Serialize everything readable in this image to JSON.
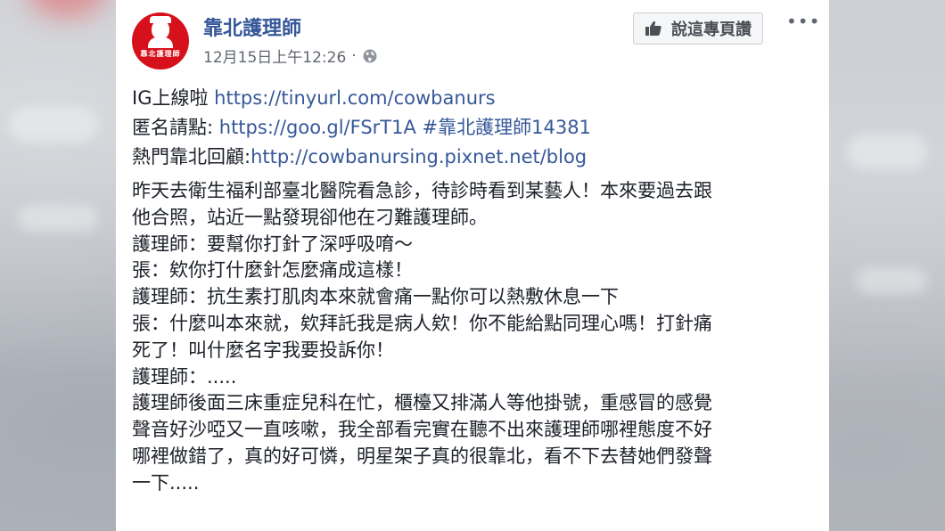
{
  "post": {
    "page_name": "靠北護理師",
    "avatar_text": "靠北護理師",
    "timestamp": "12月15日上午12:26",
    "separator": "·",
    "like_page_label": "說這專頁讚",
    "more_label": "•••"
  },
  "links": [
    {
      "prefix": "IG上線啦 ",
      "link": "https://tinyurl.com/cowbanurs"
    },
    {
      "prefix": "匿名請點: ",
      "link": "https://goo.gl/FSrT1A #靠北護理師14381"
    },
    {
      "prefix": "熱門靠北回顧:",
      "link": "http://cowbanursing.pixnet.net/blog"
    }
  ],
  "body_lines": [
    "昨天去衛生福利部臺北醫院看急診，待診時看到某藝人！本來要過去跟",
    "他合照，站近一點發現卻他在刁難護理師。",
    "護理師：要幫你打針了深呼吸唷～",
    "張：欸你打什麼針怎麼痛成這樣！",
    "護理師：抗生素打肌肉本來就會痛一點你可以熱敷休息一下",
    "張：什麼叫本來就，欸拜託我是病人欸！你不能給點同理心嗎！打針痛",
    "死了！叫什麼名字我要投訴你！",
    "護理師：.....",
    "護理師後面三床重症兒科在忙，櫃檯又排滿人等他掛號，重感冒的感覺",
    "聲音好沙啞又一直咳嗽，我全部看完實在聽不出來護理師哪裡態度不好",
    "哪裡做錯了，真的好可憐，明星架子真的很靠北，看不下去替她們發聲",
    "一下....."
  ],
  "colors": {
    "link": "#365899",
    "text": "#1d2129",
    "meta": "#616770",
    "avatar_bg": "#d6111c"
  }
}
